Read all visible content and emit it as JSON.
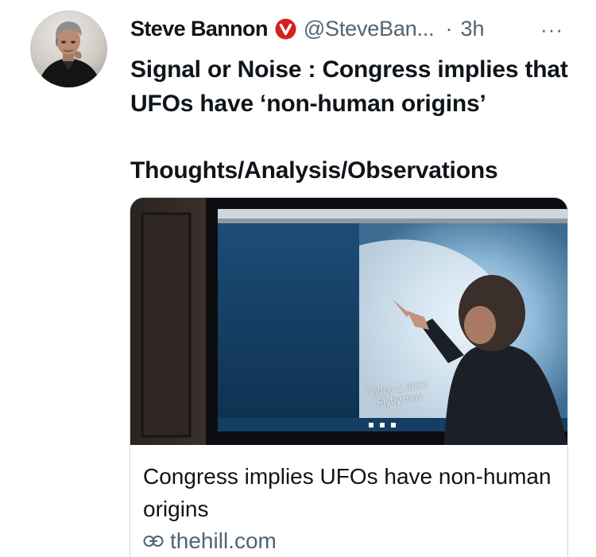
{
  "tweet": {
    "author_name": "Steve Bannon",
    "author_handle": "@SteveBan...",
    "separator": "·",
    "timestamp": "3h",
    "more_label": "···",
    "text_line1": "Signal or Noise : Congress implies that UFOs have ‘non-human origins’",
    "text_line2": "Thoughts/Analysis/Observations"
  },
  "card": {
    "image_caption_line1": "Video 1 2021",
    "image_caption_line2": "Flyby.mov",
    "title": "Congress implies UFOs have non-human origins",
    "domain": "thehill.com"
  },
  "icons": {
    "verified": "verified-badge-icon",
    "link": "link-icon",
    "more": "more-options-icon"
  },
  "colors": {
    "verified_badge": "#d61f1f",
    "secondary_text": "#536471",
    "primary_text": "#0f1419",
    "card_border": "#cfd9de"
  }
}
